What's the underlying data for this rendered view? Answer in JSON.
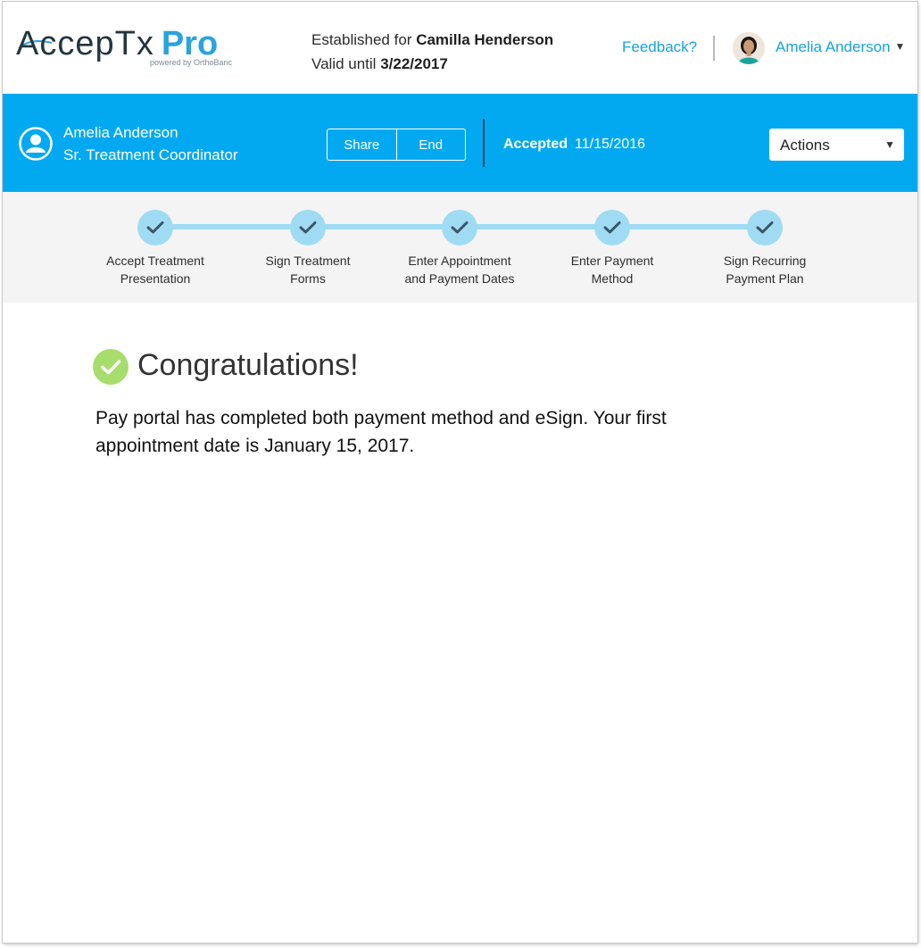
{
  "header": {
    "logo_text": "AccepTx",
    "logo_pro": "Pro",
    "logo_sub": "powered by OrthoBanc",
    "established_label": "Established for",
    "established_name": "Camilla Henderson",
    "valid_label": "Valid until",
    "valid_date": "3/22/2017",
    "feedback_link": "Feedback?",
    "user_name": "Amelia Anderson"
  },
  "bar": {
    "coordinator_name": "Amelia Anderson",
    "coordinator_title": "Sr. Treatment Coordinator",
    "share_label": "Share",
    "end_label": "End",
    "status_label": "Accepted",
    "status_date": "11/15/2016",
    "actions_label": "Actions"
  },
  "steps": [
    {
      "line1": "Accept Treatment",
      "line2": "Presentation"
    },
    {
      "line1": "Sign Treatment",
      "line2": "Forms"
    },
    {
      "line1": "Enter Appointment",
      "line2": "and Payment Dates"
    },
    {
      "line1": "Enter Payment",
      "line2": "Method"
    },
    {
      "line1": "Sign Recurring",
      "line2": "Payment Plan"
    }
  ],
  "content": {
    "title": "Congratulations!",
    "message": "Pay portal has completed both payment method and eSign. Your first appointment date is January 15, 2017."
  },
  "colors": {
    "brand_blue": "#03a9f0",
    "link_blue": "#17a3dc",
    "step_complete": "#9fdcf3",
    "success_green": "#a6dd6c"
  },
  "icons": {
    "step": "check-icon",
    "success": "check-circle-icon",
    "coordinator": "user-icon"
  }
}
